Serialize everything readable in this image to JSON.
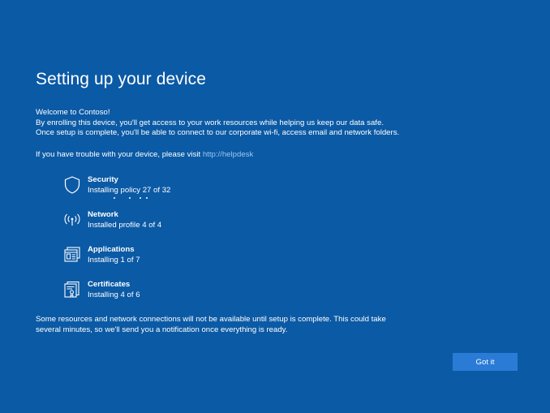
{
  "page": {
    "title": "Setting up your device",
    "background_color": "#0b5aa5"
  },
  "intro": {
    "lines": [
      "Welcome to Contoso!",
      "By enrolling this device, you'll get access to your work resources while helping us keep our data safe.",
      "Once setup is complete, you'll be able to connect to our corporate wi-fi, access email and network folders."
    ]
  },
  "help": {
    "text": "If you have trouble with your device, please visit ",
    "link_text": "http://helpdesk",
    "link_color": "#9ec6ef"
  },
  "steps": [
    {
      "name": "Security",
      "status": "Installing policy 27 of 32",
      "icon": "shield-icon"
    },
    {
      "name": "Network",
      "status": "Installed profile 4 of 4",
      "icon": "wireless-icon"
    },
    {
      "name": "Applications",
      "status": "Installing 1 of 7",
      "icon": "applications-icon"
    },
    {
      "name": "Certificates",
      "status": "Installing 4 of 6",
      "icon": "certificate-icon"
    }
  ],
  "footer": {
    "lines": [
      "Some resources and network connections will not be available until setup is complete. This could take",
      "several minutes, so we'll send you a notification once everything is ready."
    ]
  },
  "actions": {
    "got_it_label": "Got it",
    "button_color": "#2a7bd6"
  }
}
